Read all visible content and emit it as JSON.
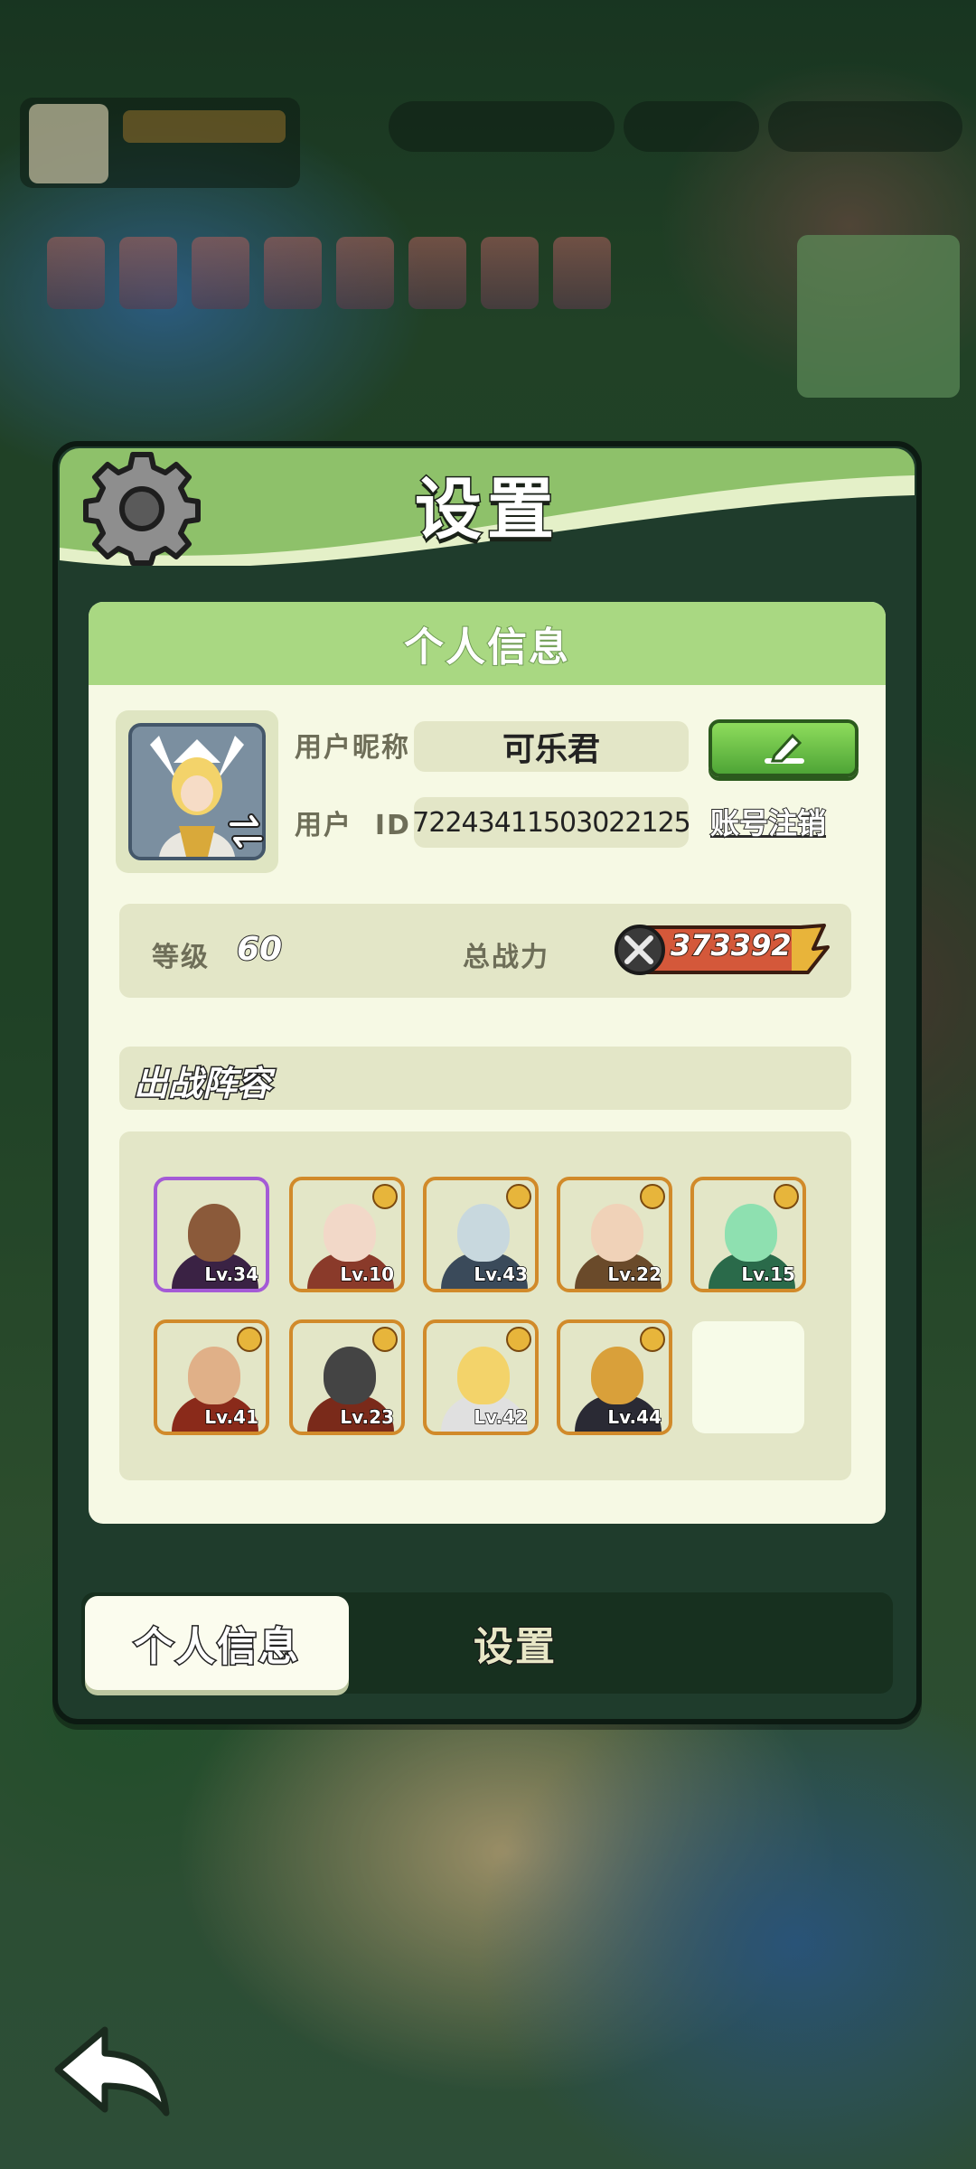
{
  "dialog": {
    "title": "设置",
    "section_title": "个人信息"
  },
  "profile": {
    "nickname_label": "用户昵称",
    "nickname": "可乐君",
    "id_label": "用户  ID",
    "user_id": "72243411503022125",
    "cancel_account": "账号注销"
  },
  "stats": {
    "level_label": "等级",
    "level": "60",
    "power_label": "总战力",
    "power": "373392"
  },
  "lineup": {
    "title": "出战阵容",
    "heroes": [
      {
        "level": "Lv.34",
        "frame": "purple",
        "color": "#4a2c5c"
      },
      {
        "level": "Lv.10",
        "frame": "orange",
        "color": "#8a4a3a"
      },
      {
        "level": "Lv.43",
        "frame": "orange",
        "color": "#5a4a44"
      },
      {
        "level": "Lv.22",
        "frame": "orange",
        "color": "#9a6a2a"
      },
      {
        "level": "Lv.15",
        "frame": "orange",
        "color": "#2f6a54"
      },
      {
        "level": "Lv.41",
        "frame": "orange",
        "color": "#6a3a26"
      },
      {
        "level": "Lv.23",
        "frame": "orange",
        "color": "#5a3a2e"
      },
      {
        "level": "Lv.42",
        "frame": "orange",
        "color": "#7a6a40"
      },
      {
        "level": "Lv.44",
        "frame": "orange",
        "color": "#4a3a2a"
      }
    ]
  },
  "tabs": {
    "personal": "个人信息",
    "settings": "设置"
  },
  "colors": {
    "header_green": "#a9d882",
    "card_bg": "#f6f9e4",
    "frame_dark": "#1f3c2c",
    "button_green": "#4ea536"
  }
}
